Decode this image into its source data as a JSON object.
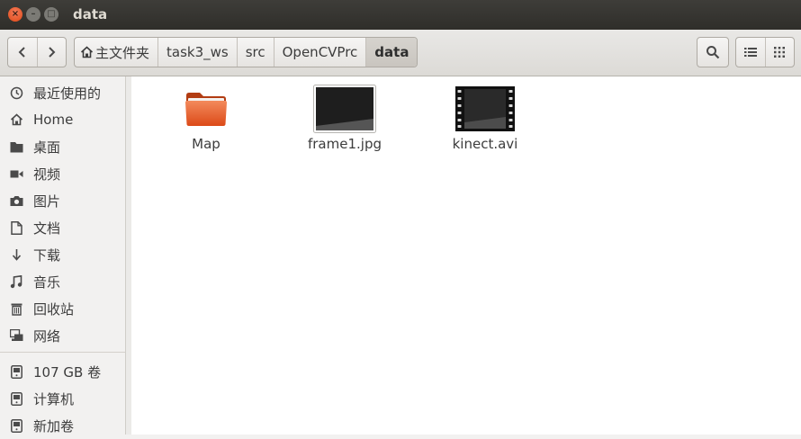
{
  "window": {
    "title": "data"
  },
  "toolbar": {
    "breadcrumbs": [
      "主文件夹",
      "task3_ws",
      "src",
      "OpenCVPrc",
      "data"
    ]
  },
  "sidebar": {
    "items": [
      {
        "label": "最近使用的",
        "icon": "clock-icon"
      },
      {
        "label": "Home",
        "icon": "home-icon"
      },
      {
        "label": "桌面",
        "icon": "folder-icon"
      },
      {
        "label": "视频",
        "icon": "video-icon"
      },
      {
        "label": "图片",
        "icon": "camera-icon"
      },
      {
        "label": "文档",
        "icon": "document-icon"
      },
      {
        "label": "下载",
        "icon": "download-icon"
      },
      {
        "label": "音乐",
        "icon": "music-icon"
      },
      {
        "label": "回收站",
        "icon": "trash-icon"
      },
      {
        "label": "网络",
        "icon": "network-icon"
      }
    ],
    "devices": [
      {
        "label": "107 GB 卷",
        "icon": "drive-icon"
      },
      {
        "label": "计算机",
        "icon": "drive-icon"
      },
      {
        "label": "新加卷",
        "icon": "drive-icon"
      }
    ]
  },
  "files": [
    {
      "name": "Map",
      "type": "folder"
    },
    {
      "name": "frame1.jpg",
      "type": "image"
    },
    {
      "name": "kinect.avi",
      "type": "video"
    }
  ],
  "colors": {
    "accent": "#e95420",
    "titlebar": "#3c3b37"
  }
}
